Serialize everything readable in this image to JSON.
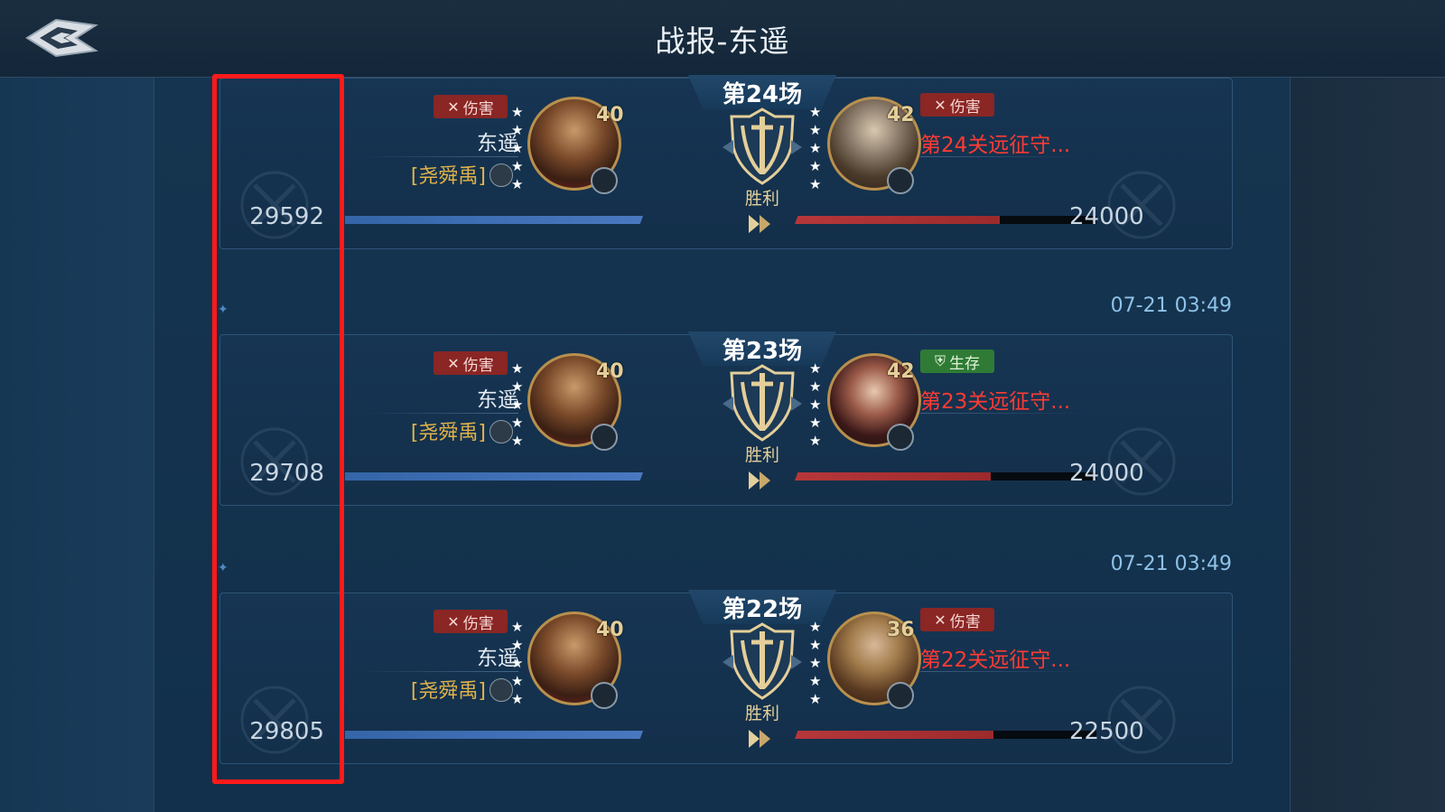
{
  "header": {
    "title": "战报-东遥",
    "back_icon": "back-arrow-icon"
  },
  "colors": {
    "victory_gold": "#e4cf9a",
    "enemy_red": "#ff3b33",
    "highlight_red": "#ff1a1a",
    "player_bar": "#3465a8",
    "enemy_bar": "#b6373a"
  },
  "battles": [
    {
      "round": "第24场",
      "result": "胜利",
      "player": {
        "role_badge": "伤害",
        "name": "东遥",
        "tag": "[尧舜禹]",
        "level": "40",
        "stars": "5",
        "score": "29592",
        "troop_icon": "cavalry-icon"
      },
      "enemy": {
        "role_badge": "伤害",
        "role_type": "damage",
        "name": "第24关远征守...",
        "level": "42",
        "stars": "5",
        "score": "24000",
        "troop_icon": "spear-icon",
        "hp_remaining": 0.68
      }
    },
    {
      "round": "第23场",
      "result": "胜利",
      "timestamp": "07-21 03:49",
      "player": {
        "role_badge": "伤害",
        "name": "东遥",
        "tag": "[尧舜禹]",
        "level": "40",
        "stars": "5",
        "score": "29708",
        "troop_icon": "cavalry-icon"
      },
      "enemy": {
        "role_badge": "生存",
        "role_type": "survive",
        "name": "第23关远征守...",
        "level": "42",
        "stars": "5",
        "score": "24000",
        "troop_icon": "fist-icon",
        "hp_remaining": 0.65
      }
    },
    {
      "round": "第22场",
      "result": "胜利",
      "timestamp": "07-21 03:49",
      "player": {
        "role_badge": "伤害",
        "name": "东遥",
        "tag": "[尧舜禹]",
        "level": "40",
        "stars": "5",
        "score": "29805",
        "troop_icon": "cavalry-icon"
      },
      "enemy": {
        "role_badge": "伤害",
        "role_type": "damage",
        "name": "第22关远征守...",
        "level": "36",
        "stars": "5",
        "score": "22500",
        "troop_icon": "spear-icon",
        "hp_remaining": 0.66
      }
    }
  ]
}
